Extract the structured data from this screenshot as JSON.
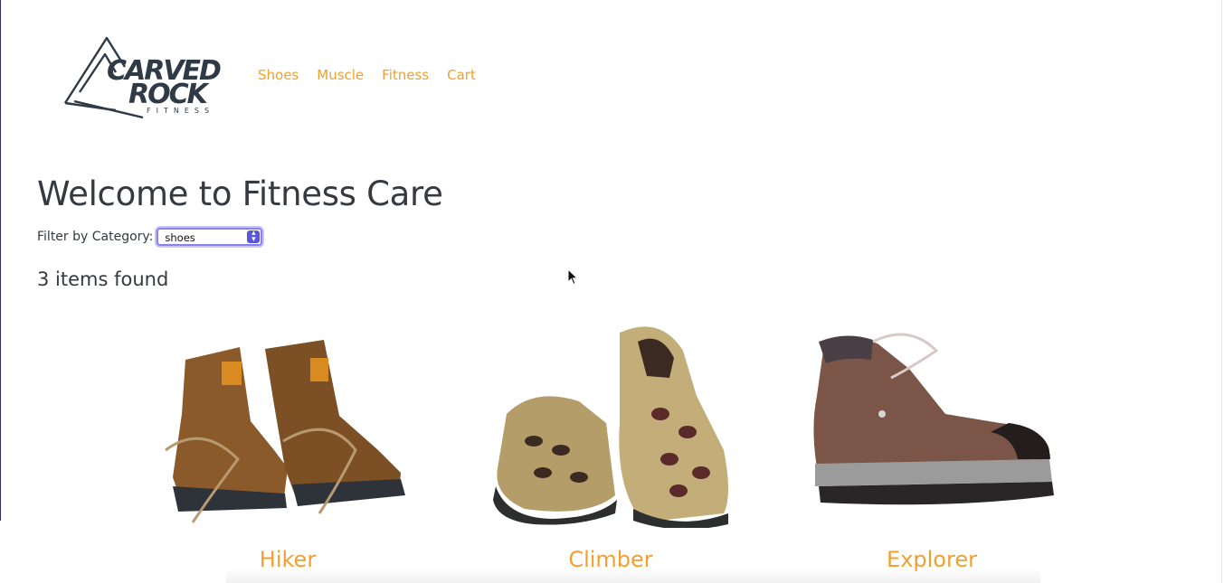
{
  "brand": {
    "logo_line1": "CARVED",
    "logo_line2": "ROCK",
    "logo_line3": "FITNESS"
  },
  "nav": {
    "items": [
      {
        "label": "Shoes"
      },
      {
        "label": "Muscle"
      },
      {
        "label": "Fitness"
      },
      {
        "label": "Cart"
      }
    ]
  },
  "main": {
    "title": "Welcome to Fitness Care",
    "filter_label": "Filter by Category:",
    "filter_value": "shoes",
    "count_text": "3 items found"
  },
  "products": [
    {
      "name": "Hiker",
      "icon": "hiking-boots-image"
    },
    {
      "name": "Climber",
      "icon": "sandals-image"
    },
    {
      "name": "Explorer",
      "icon": "boot-image"
    }
  ],
  "colors": {
    "accent": "#f0a030",
    "text": "#343a40",
    "select_focus": "#8a82e8"
  }
}
